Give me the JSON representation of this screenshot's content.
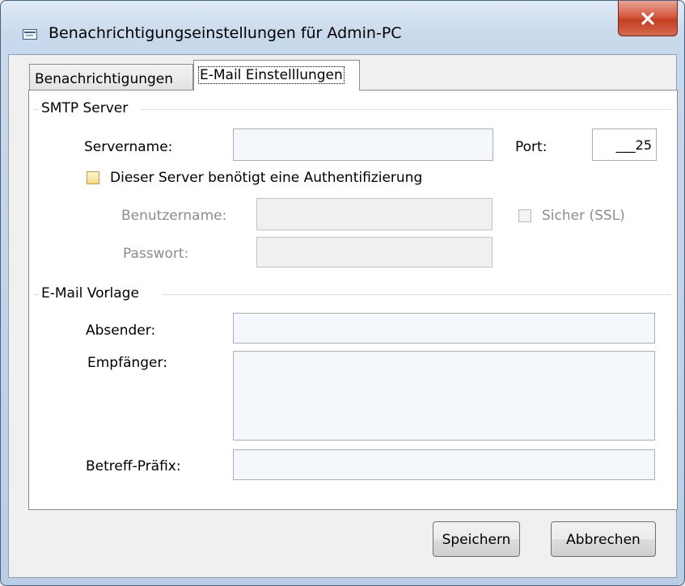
{
  "window": {
    "title": "Benachrichtigungseinstellungen für Admin-PC",
    "close_glyph": "X",
    "title_icon": "window-icon"
  },
  "tabs": [
    {
      "label": "Benachrichtigungen",
      "active": false
    },
    {
      "label": "E-Mail Einstelllungen",
      "active": true
    }
  ],
  "smtp": {
    "group_title": "SMTP Server",
    "servername_label": "Servername:",
    "servername_value": "",
    "port_label": "Port:",
    "port_value": "___25",
    "auth_label": "Dieser Server benötigt eine Authentifizierung",
    "auth_checked": false,
    "username_label": "Benutzername:",
    "username_value": "",
    "ssl_label": "Sicher (SSL)",
    "ssl_checked": false,
    "password_label": "Passwort:",
    "password_value": ""
  },
  "template": {
    "group_title": "E-Mail Vorlage",
    "sender_label": "Absender:",
    "sender_value": "",
    "recipient_label": "Empfänger:",
    "recipient_value": "",
    "subject_prefix_label": "Betreff-Präfix:",
    "subject_prefix_value": ""
  },
  "buttons": {
    "save": "Speichern",
    "cancel": "Abbrechen"
  },
  "colors": {
    "close_button": "#c9472b",
    "checkbox_border": "#c99a2e",
    "frame": "#b9cde4"
  }
}
